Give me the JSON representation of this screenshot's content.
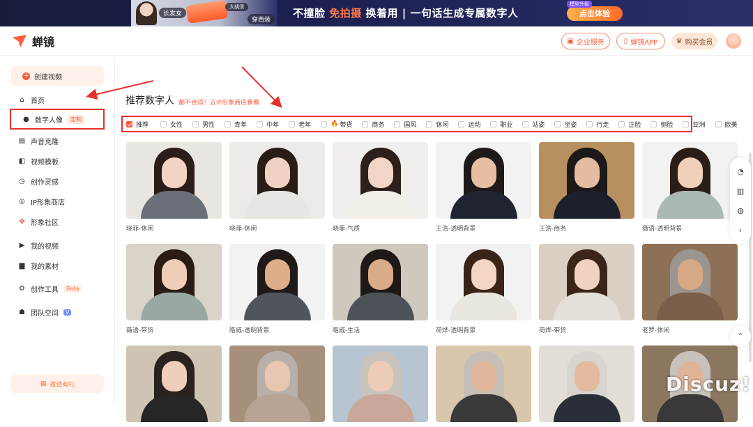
{
  "banner": {
    "tag_long_hair": "长发女",
    "tag_beard": "大胡须",
    "tag_suit": "穿西装",
    "slogan_a": "不撞脸",
    "slogan_b": "免拍摄",
    "slogan_c": "换着用",
    "slogan_d": "| 一句话生成专属数字人",
    "cta_badge": "模型升级",
    "cta": "点击体验"
  },
  "header": {
    "logo": "蝉镜",
    "enterprise": "企业服务",
    "app": "蝉镜APP",
    "vip": "购买会员"
  },
  "sidebar": {
    "create": "创建视频",
    "items": [
      {
        "label": "首页",
        "icon": "home-icon"
      },
      {
        "label": "数字人像",
        "icon": "person-icon",
        "badge": "定制"
      },
      {
        "label": "声音克隆",
        "icon": "voice-icon"
      },
      {
        "label": "视频模板",
        "icon": "template-icon"
      },
      {
        "label": "创作灵感",
        "icon": "inspiration-icon"
      },
      {
        "label": "IP形象商店",
        "icon": "store-icon"
      },
      {
        "label": "形象社区",
        "icon": "community-icon"
      },
      {
        "label": "我的视频",
        "icon": "play-icon"
      },
      {
        "label": "我的素材",
        "icon": "folder-icon"
      },
      {
        "label": "创作工具",
        "icon": "tool-icon",
        "badge": "Beta"
      },
      {
        "label": "团队空间",
        "icon": "team-icon",
        "badge": "V"
      }
    ],
    "invite": "邀请有礼"
  },
  "main": {
    "title": "推荐数字人",
    "subtitle": "都不合适？去IP形象商店看看",
    "filters": [
      "推荐",
      "女性",
      "男性",
      "青年",
      "中年",
      "老年",
      "带货",
      "商务",
      "国风",
      "休闲",
      "运动",
      "职业",
      "站姿",
      "坐姿",
      "行走",
      "正脸",
      "侧脸",
      "亚洲",
      "欧美"
    ],
    "cards": [
      {
        "caption": "晓菲-休闲",
        "skin": "#f2d4c4",
        "hair": "#2b1d18",
        "body": "#6a6f78",
        "bg": "#e9e6e2"
      },
      {
        "caption": "晓菲-休闲",
        "skin": "#f0d2c2",
        "hair": "#2a1c17",
        "body": "#e8e6e2",
        "bg": "#ecebe8"
      },
      {
        "caption": "晓菲-气质",
        "skin": "#f1d5c6",
        "hair": "#2d1f19",
        "body": "#f2efe9",
        "bg": "#f0efed"
      },
      {
        "caption": "王浩-透明背景",
        "skin": "#e6bfa2",
        "hair": "#1d1a19",
        "body": "#1f2430",
        "bg": "#f2f2f2"
      },
      {
        "caption": "王浩-商务",
        "skin": "#e4bc9f",
        "hair": "#1c1918",
        "body": "#1c202b",
        "bg": "#b8905f"
      },
      {
        "caption": "薇语-透明背景",
        "skin": "#f0d0bb",
        "hair": "#2c1e17",
        "body": "#a9b8b3",
        "bg": "#f2f2f2"
      },
      {
        "caption": "薇语-带货",
        "skin": "#efcdb7",
        "hair": "#2a1c15",
        "body": "#9aa8a3",
        "bg": "#d9d3c8"
      },
      {
        "caption": "皓威-透明背景",
        "skin": "#dcae8a",
        "hair": "#1f1a17",
        "body": "#50555c",
        "bg": "#f2f2f2"
      },
      {
        "caption": "皓威-生活",
        "skin": "#d9ab87",
        "hair": "#1e1916",
        "body": "#4d5259",
        "bg": "#cfc8bd"
      },
      {
        "caption": "荷烨-透明背景",
        "skin": "#f3d5c3",
        "hair": "#3a2418",
        "body": "#e9e5df",
        "bg": "#f2f2f2"
      },
      {
        "caption": "荷烨-带货",
        "skin": "#f1d2c0",
        "hair": "#3b2519",
        "body": "#e4dfd8",
        "bg": "#d9cfc2"
      },
      {
        "caption": "老罗-休闲",
        "skin": "#d6a886",
        "hair": "#9a958f",
        "body": "#7a5f4a",
        "bg": "#8d7157"
      },
      {
        "caption": "",
        "skin": "#efcfbc",
        "hair": "#2a221f",
        "body": "#262626",
        "bg": "#cfc3b3"
      },
      {
        "caption": "",
        "skin": "#e8c6b0",
        "hair": "#b7b0aa",
        "body": "#b9a394",
        "bg": "#a6907c"
      },
      {
        "caption": "",
        "skin": "#ecccb8",
        "hair": "#c9c3bd",
        "body": "#c9a89b",
        "bg": "#b7c5d2"
      },
      {
        "caption": "",
        "skin": "#e0b79a",
        "hair": "#c4beb7",
        "body": "#3a3a3a",
        "bg": "#d8c7ad"
      },
      {
        "caption": "",
        "skin": "#e2ba9d",
        "hair": "#d8d4cf",
        "body": "#2a2e38",
        "bg": "#e2ddd6"
      },
      {
        "caption": "",
        "skin": "#deb598",
        "hair": "#c7c1bb",
        "body": "#3a3838",
        "bg": "#8b7760"
      }
    ]
  },
  "float": {
    "top_label": "⌃"
  },
  "watermark": "Discuz!"
}
